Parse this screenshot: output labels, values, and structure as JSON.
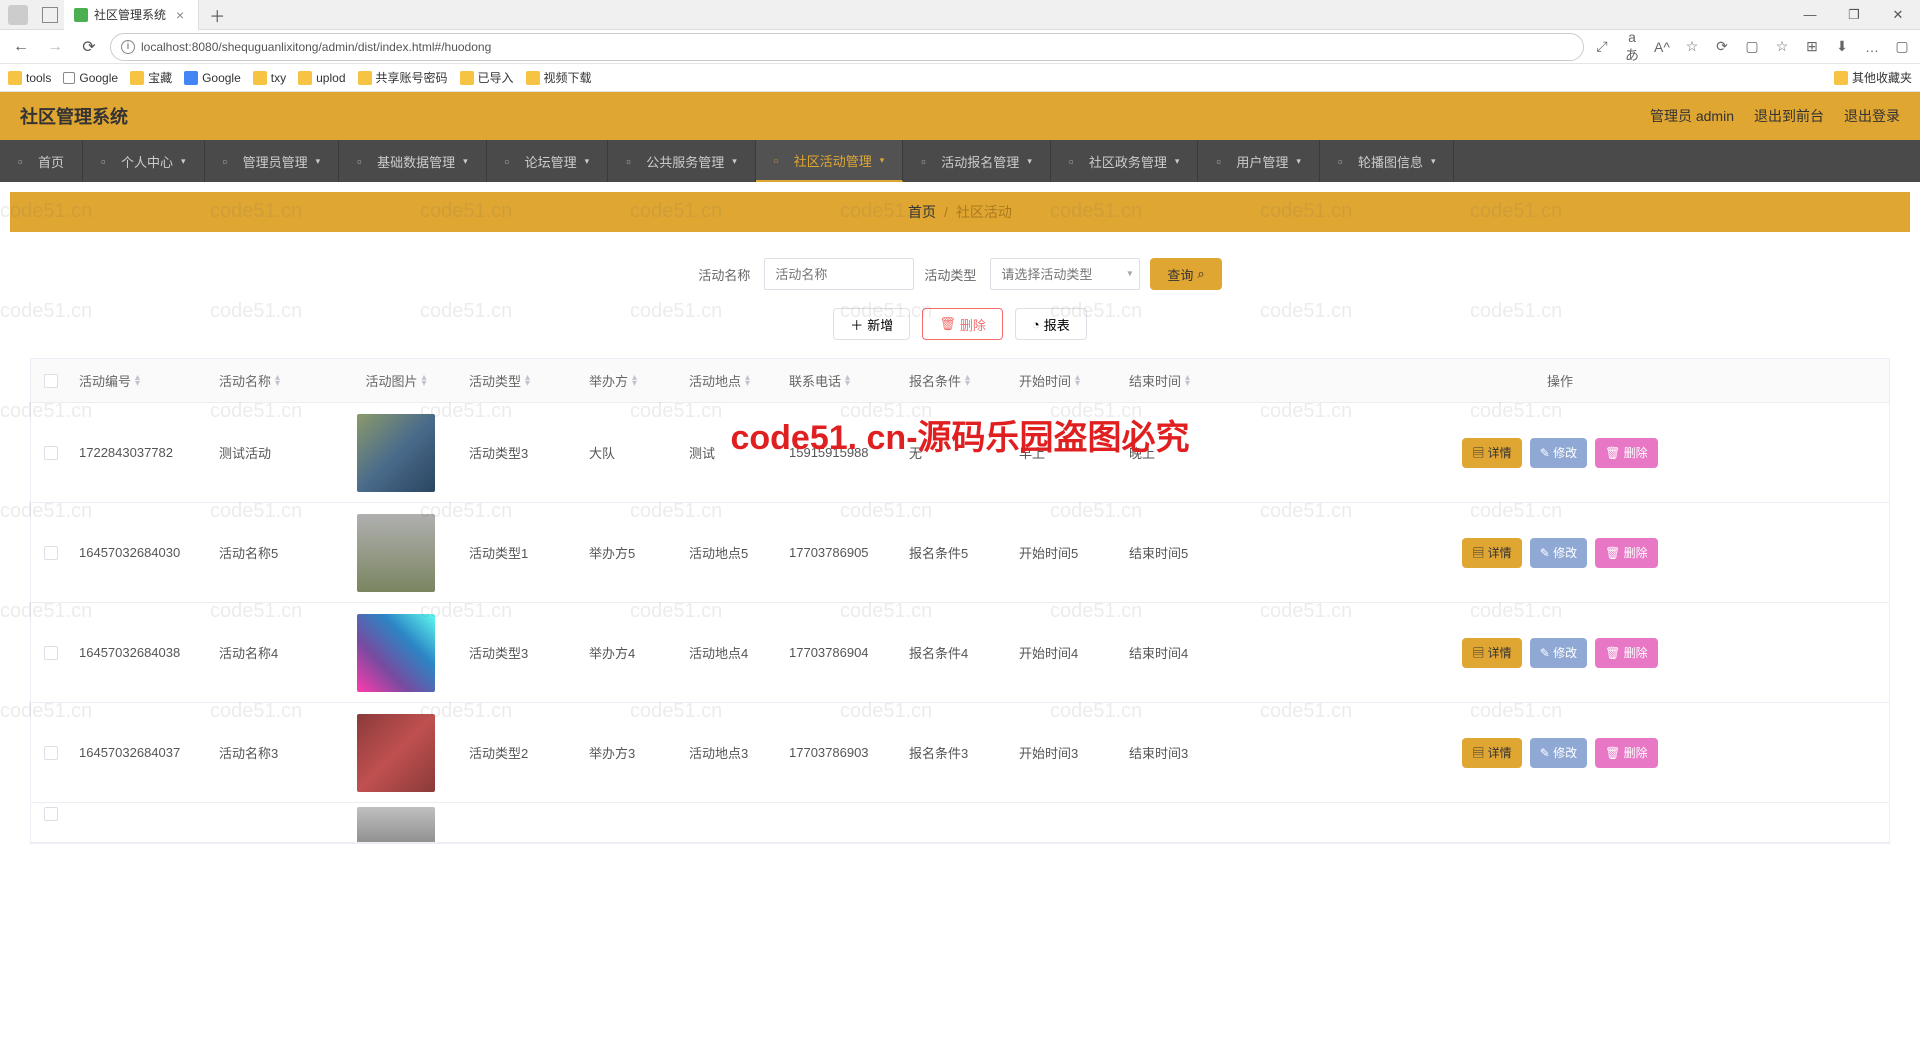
{
  "browser": {
    "tab_title": "社区管理系统",
    "url": "localhost:8080/shequguanlixitong/admin/dist/index.html#/huodong",
    "win_min": "—",
    "win_max": "❐",
    "win_close": "✕",
    "addr_icons": [
      "⤢",
      "aあ",
      "A^",
      "☆",
      "⟳",
      "▢",
      "☆",
      "⊞",
      "⬇",
      "…",
      "▢"
    ]
  },
  "bookmarks": {
    "items": [
      "tools",
      "Google",
      "宝藏",
      "Google",
      "txy",
      "uplod",
      "共享账号密码",
      "已导入",
      "视频下载"
    ],
    "other": "其他收藏夹"
  },
  "header": {
    "title": "社区管理系统",
    "admin_label": "管理员 admin",
    "to_front": "退出到前台",
    "logout": "退出登录"
  },
  "nav": {
    "items": [
      "首页",
      "个人中心",
      "管理员管理",
      "基础数据管理",
      "论坛管理",
      "公共服务管理",
      "社区活动管理",
      "活动报名管理",
      "社区政务管理",
      "用户管理",
      "轮播图信息"
    ],
    "active_index": 6
  },
  "breadcrumb": {
    "home": "首页",
    "sep": "/",
    "current": "社区活动"
  },
  "filter": {
    "name_label": "活动名称",
    "name_placeholder": "活动名称",
    "type_label": "活动类型",
    "type_placeholder": "请选择活动类型",
    "search_btn": "查询"
  },
  "actions": {
    "add": "新增",
    "del": "删除",
    "report": "报表"
  },
  "table": {
    "headers": [
      "活动编号",
      "活动名称",
      "活动图片",
      "活动类型",
      "举办方",
      "活动地点",
      "联系电话",
      "报名条件",
      "开始时间",
      "结束时间",
      "操作"
    ],
    "ops": {
      "detail": "详情",
      "edit": "修改",
      "del": "删除"
    },
    "rows": [
      {
        "id": "1722843037782",
        "name": "测试活动",
        "type": "活动类型3",
        "org": "大队",
        "loc": "测试",
        "phone": "15915915988",
        "cond": "无",
        "start": "早上",
        "end": "晚上",
        "img": "img1"
      },
      {
        "id": "16457032684030",
        "name": "活动名称5",
        "type": "活动类型1",
        "org": "举办方5",
        "loc": "活动地点5",
        "phone": "17703786905",
        "cond": "报名条件5",
        "start": "开始时间5",
        "end": "结束时间5",
        "img": "img2"
      },
      {
        "id": "16457032684038",
        "name": "活动名称4",
        "type": "活动类型3",
        "org": "举办方4",
        "loc": "活动地点4",
        "phone": "17703786904",
        "cond": "报名条件4",
        "start": "开始时间4",
        "end": "结束时间4",
        "img": "img3"
      },
      {
        "id": "16457032684037",
        "name": "活动名称3",
        "type": "活动类型2",
        "org": "举办方3",
        "loc": "活动地点3",
        "phone": "17703786903",
        "cond": "报名条件3",
        "start": "开始时间3",
        "end": "结束时间3",
        "img": "img4"
      },
      {
        "id": "",
        "name": "",
        "type": "",
        "org": "",
        "loc": "",
        "phone": "",
        "cond": "",
        "start": "",
        "end": "",
        "img": "img5"
      }
    ]
  },
  "watermark": "code51. cn-源码乐园盗图必究",
  "watermark_bg": "code51.cn"
}
